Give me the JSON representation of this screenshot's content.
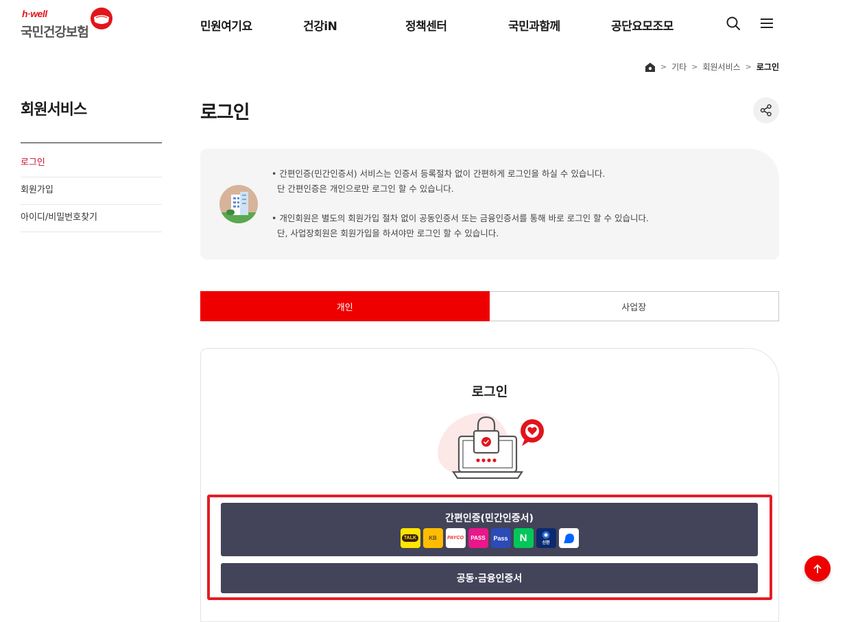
{
  "brand": {
    "tagline": "h·well",
    "name": "국민건강보험",
    "accent_color": "#e2141c"
  },
  "nav": {
    "items": [
      "민원여기요",
      "건강iN",
      "정책센터",
      "국민과함께",
      "공단요모조모"
    ],
    "search_icon": "search-icon",
    "menu_icon": "hamburger-menu-icon"
  },
  "breadcrumb": {
    "home_icon": "home-icon",
    "items": [
      "기타",
      "회원서비스"
    ],
    "current": "로그인"
  },
  "sidebar": {
    "title": "회원서비스",
    "items": [
      {
        "label": "로그인",
        "active": true
      },
      {
        "label": "회원가입",
        "active": false
      },
      {
        "label": "아이디/비밀번호찾기",
        "active": false
      }
    ]
  },
  "page": {
    "title": "로그인",
    "share_icon": "share-icon"
  },
  "notice": {
    "icon": "building-icon",
    "lines": [
      "• 간편인증(민간인증서) 서비스는 인증서 등록절차 없이 간편하게 로그인을 하실 수 있습니다.",
      "  단 간편인증은 개인으로만 로그인 할 수 있습니다.",
      "• 개인회원은 별도의 회원가입 절차 없이 공동인증서 또는 금융인증서를 통해 바로 로그인 할 수 있습니다.",
      "  단, 사업장회원은 회원가입을 하셔야만 로그인 할 수 있습니다."
    ]
  },
  "tabs": [
    {
      "label": "개인",
      "active": true
    },
    {
      "label": "사업장",
      "active": false
    }
  ],
  "login": {
    "title": "로그인",
    "easy_auth_label": "간편인증(민간인증서)",
    "providers": [
      {
        "name": "kakao-talk",
        "text": "TALK",
        "bg": "#fee500",
        "fg": "#3c1e1e"
      },
      {
        "name": "kb-bank",
        "text": "KB",
        "bg": "#ffbc00",
        "fg": "#5a4a2a"
      },
      {
        "name": "payco",
        "text": "PAYCO",
        "bg": "#ffffff",
        "fg": "#e42b2b"
      },
      {
        "name": "pass-skt",
        "text": "PASS",
        "bg": "#e8178a",
        "fg": "#ffffff"
      },
      {
        "name": "pass-kt",
        "text": "Pass",
        "bg": "#2c4bb8",
        "fg": "#ffffff"
      },
      {
        "name": "naver",
        "text": "N",
        "bg": "#03c75a",
        "fg": "#ffffff"
      },
      {
        "name": "shinhan",
        "text": "신한",
        "bg": "#0b2a6f",
        "fg": "#ffffff"
      },
      {
        "name": "toss",
        "text": "",
        "bg": "#ffffff",
        "fg": "#0064ff"
      }
    ],
    "cert_label": "공동·금융인증서",
    "button_color": "#434359",
    "highlight_color": "#e21e26"
  },
  "to_top_icon": "arrow-up-icon"
}
